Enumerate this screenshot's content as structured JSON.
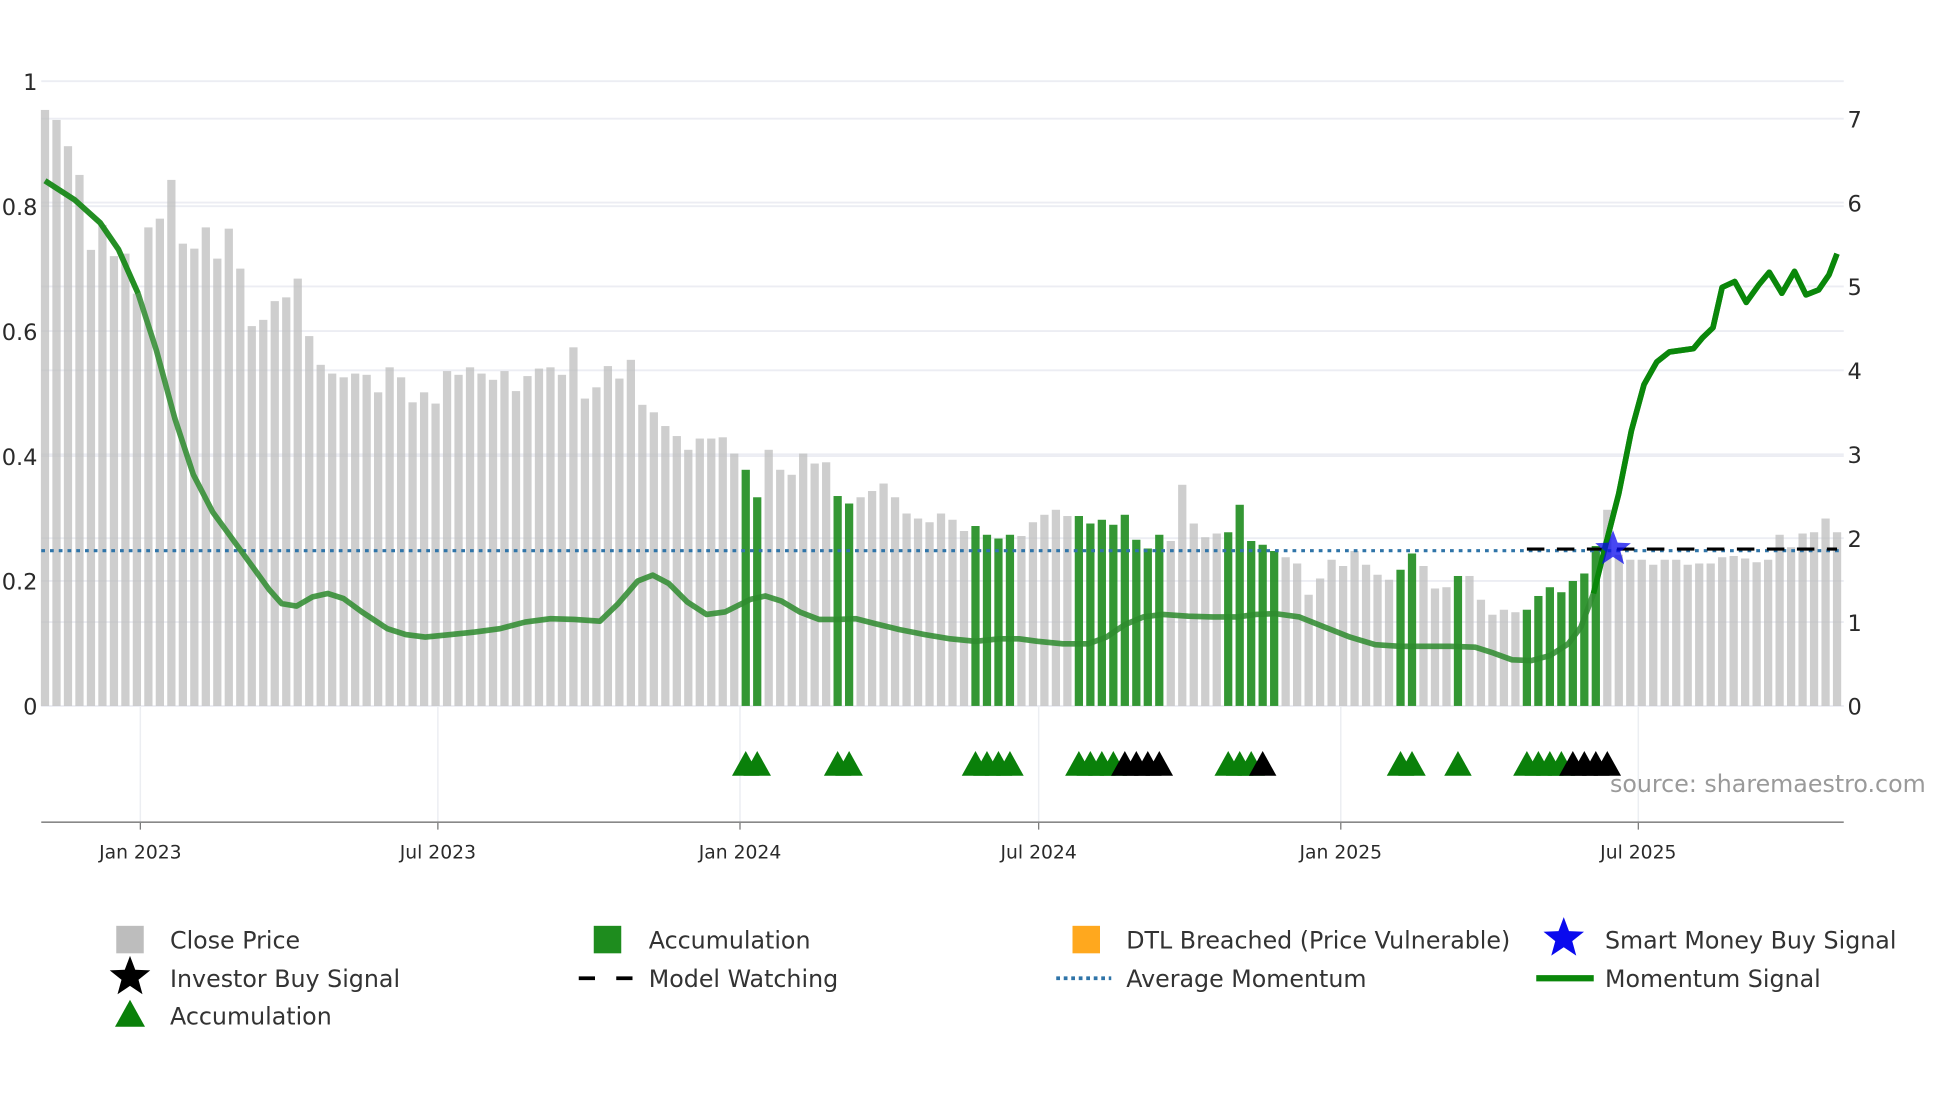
{
  "chart_data": {
    "type": "bar",
    "title": "",
    "source": "source: sharemaestro.com",
    "x_unit": "week index",
    "left_axis": {
      "ticks": [
        "0",
        "0.2",
        "0.4",
        "0.6",
        "0.8",
        "1"
      ],
      "range": [
        0,
        1
      ]
    },
    "right_axis": {
      "ticks": [
        "0",
        "1",
        "2",
        "3",
        "4",
        "5",
        "6",
        "7"
      ],
      "range": [
        0,
        7
      ]
    },
    "x_ticks": [
      {
        "label": "Jan 2023",
        "week": 8.3
      },
      {
        "label": "Jul 2023",
        "week": 34.2
      },
      {
        "label": "Jan 2024",
        "week": 60.5
      },
      {
        "label": "Jul 2024",
        "week": 86.5
      },
      {
        "label": "Jan 2025",
        "week": 112.8
      },
      {
        "label": "Jul 2025",
        "week": 138.7
      }
    ],
    "close_price": [
      0.954,
      0.938,
      0.896,
      0.85,
      0.73,
      0.77,
      0.72,
      0.724,
      0.66,
      0.766,
      0.78,
      0.842,
      0.74,
      0.732,
      0.766,
      0.716,
      0.764,
      0.7,
      0.608,
      0.618,
      0.648,
      0.654,
      0.684,
      0.592,
      0.546,
      0.532,
      0.526,
      0.532,
      0.53,
      0.502,
      0.542,
      0.526,
      0.486,
      0.502,
      0.484,
      0.536,
      0.53,
      0.542,
      0.532,
      0.522,
      0.536,
      0.504,
      0.528,
      0.54,
      0.542,
      0.53,
      0.574,
      0.492,
      0.51,
      0.544,
      0.524,
      0.554,
      0.482,
      0.47,
      0.448,
      0.432,
      0.41,
      0.428,
      0.428,
      0.43,
      0.404,
      0.378,
      0.334,
      0.41,
      0.378,
      0.37,
      0.404,
      0.388,
      0.39,
      0.336,
      0.324,
      0.334,
      0.344,
      0.356,
      0.334,
      0.308,
      0.3,
      0.294,
      0.308,
      0.298,
      0.28,
      0.288,
      0.274,
      0.268,
      0.274,
      0.272,
      0.294,
      0.306,
      0.314,
      0.304,
      0.304,
      0.292,
      0.298,
      0.29,
      0.306,
      0.266,
      0.252,
      0.274,
      0.264,
      0.354,
      0.292,
      0.27,
      0.276,
      0.278,
      0.322,
      0.264,
      0.258,
      0.248,
      0.238,
      0.228,
      0.178,
      0.204,
      0.234,
      0.224,
      0.248,
      0.226,
      0.21,
      0.202,
      0.218,
      0.244,
      0.224,
      0.188,
      0.19,
      0.208,
      0.208,
      0.17,
      0.146,
      0.154,
      0.15,
      0.154,
      0.176,
      0.19,
      0.182,
      0.2,
      0.212,
      0.256,
      0.314,
      0.242,
      0.234,
      0.234,
      0.226,
      0.234,
      0.234,
      0.226,
      0.228,
      0.228,
      0.238,
      0.24,
      0.236,
      0.23,
      0.234,
      0.274,
      0.254,
      0.276,
      0.278,
      0.3,
      0.278
    ],
    "accumulation_weeks": [
      61,
      62,
      69,
      70,
      81,
      82,
      83,
      84,
      90,
      91,
      92,
      93,
      94,
      95,
      96,
      97,
      103,
      104,
      105,
      106,
      107,
      118,
      119,
      123,
      129,
      130,
      131,
      132,
      133,
      134,
      135
    ],
    "accumulation_triangles": [
      61,
      62,
      69,
      70,
      81,
      82,
      83,
      84,
      90,
      91,
      92,
      93,
      103,
      104,
      105,
      118,
      119,
      123,
      129,
      130,
      131,
      132
    ],
    "investor_buy_triangles": [
      94,
      95,
      96,
      97,
      106,
      133,
      134,
      135,
      136
    ],
    "momentum_signal": [
      [
        0,
        6.26
      ],
      [
        2.6,
        6.03
      ],
      [
        4.8,
        5.76
      ],
      [
        6.4,
        5.44
      ],
      [
        8.1,
        4.92
      ],
      [
        9.7,
        4.24
      ],
      [
        11.3,
        3.43
      ],
      [
        12.9,
        2.76
      ],
      [
        14.6,
        2.31
      ],
      [
        16.2,
        2.01
      ],
      [
        17.8,
        1.71
      ],
      [
        19.5,
        1.39
      ],
      [
        20.6,
        1.22
      ],
      [
        21.9,
        1.19
      ],
      [
        23.3,
        1.3
      ],
      [
        24.6,
        1.34
      ],
      [
        26.0,
        1.28
      ],
      [
        27.6,
        1.12
      ],
      [
        29.8,
        0.92
      ],
      [
        31.4,
        0.85
      ],
      [
        33.1,
        0.82
      ],
      [
        35.3,
        0.85
      ],
      [
        37.4,
        0.88
      ],
      [
        39.6,
        0.92
      ],
      [
        41.8,
        1.0
      ],
      [
        44.0,
        1.04
      ],
      [
        46.1,
        1.03
      ],
      [
        48.3,
        1.01
      ],
      [
        49.9,
        1.22
      ],
      [
        51.6,
        1.49
      ],
      [
        52.9,
        1.56
      ],
      [
        54.3,
        1.46
      ],
      [
        55.9,
        1.24
      ],
      [
        57.6,
        1.09
      ],
      [
        59.2,
        1.12
      ],
      [
        61.4,
        1.27
      ],
      [
        62.7,
        1.31
      ],
      [
        64.1,
        1.25
      ],
      [
        65.7,
        1.12
      ],
      [
        67.4,
        1.03
      ],
      [
        69.0,
        1.03
      ],
      [
        70.6,
        1.04
      ],
      [
        72.3,
        0.98
      ],
      [
        74.4,
        0.91
      ],
      [
        76.6,
        0.85
      ],
      [
        78.8,
        0.8
      ],
      [
        81.0,
        0.77
      ],
      [
        83.1,
        0.8
      ],
      [
        84.8,
        0.8
      ],
      [
        86.4,
        0.77
      ],
      [
        88.6,
        0.74
      ],
      [
        90.8,
        0.74
      ],
      [
        92.4,
        0.82
      ],
      [
        94.0,
        0.97
      ],
      [
        95.6,
        1.06
      ],
      [
        97.3,
        1.09
      ],
      [
        99.5,
        1.07
      ],
      [
        101.6,
        1.06
      ],
      [
        103.8,
        1.06
      ],
      [
        105.4,
        1.09
      ],
      [
        107.1,
        1.1
      ],
      [
        109.2,
        1.06
      ],
      [
        111.4,
        0.94
      ],
      [
        113.6,
        0.82
      ],
      [
        115.8,
        0.73
      ],
      [
        118.0,
        0.71
      ],
      [
        120.1,
        0.71
      ],
      [
        122.3,
        0.71
      ],
      [
        124.5,
        0.7
      ],
      [
        126.1,
        0.63
      ],
      [
        127.7,
        0.55
      ],
      [
        129.4,
        0.54
      ],
      [
        131.0,
        0.6
      ],
      [
        132.6,
        0.74
      ],
      [
        133.7,
        0.94
      ],
      [
        134.8,
        1.34
      ],
      [
        135.9,
        1.94
      ],
      [
        137.0,
        2.53
      ],
      [
        138.1,
        3.28
      ],
      [
        139.2,
        3.83
      ],
      [
        140.3,
        4.1
      ],
      [
        141.4,
        4.22
      ],
      [
        142.5,
        4.24
      ],
      [
        143.5,
        4.26
      ],
      [
        144.3,
        4.39
      ],
      [
        145.2,
        4.51
      ],
      [
        146.0,
        4.99
      ],
      [
        147.1,
        5.06
      ],
      [
        148.1,
        4.81
      ],
      [
        149.2,
        5.02
      ],
      [
        150.1,
        5.17
      ],
      [
        151.2,
        4.92
      ],
      [
        152.3,
        5.18
      ],
      [
        153.3,
        4.9
      ],
      [
        154.4,
        4.96
      ],
      [
        155.3,
        5.14
      ],
      [
        156.0,
        5.39
      ]
    ],
    "average_momentum": 1.85,
    "model_watching": {
      "from_week": 129,
      "to_week": 156,
      "value": 1.87
    },
    "smart_money_buy_signal": {
      "week": 136.5,
      "value": 1.87
    },
    "legend": [
      {
        "label": "Close Price",
        "symbol": "gray-square"
      },
      {
        "label": "Accumulation",
        "symbol": "green-square"
      },
      {
        "label": "DTL Breached (Price Vulnerable)",
        "symbol": "orange-square"
      },
      {
        "label": "Smart Money Buy Signal",
        "symbol": "blue-star"
      },
      {
        "label": "Investor Buy Signal",
        "symbol": "black-star"
      },
      {
        "label": "Model Watching",
        "symbol": "black-dash"
      },
      {
        "label": "Average Momentum",
        "symbol": "blue-dotted"
      },
      {
        "label": "Momentum Signal",
        "symbol": "green-line"
      },
      {
        "label": "Accumulation",
        "symbol": "green-triangle"
      }
    ],
    "legend_placement": "bottom",
    "colors": {
      "price": "#bdbdbd",
      "accumulation": "#1e8c1e",
      "dtl": "#ffa81e",
      "smart_money": "#0a0aee",
      "investor": "#000000",
      "avg_momentum": "#2f74a8",
      "momentum": "#0a870a"
    }
  }
}
